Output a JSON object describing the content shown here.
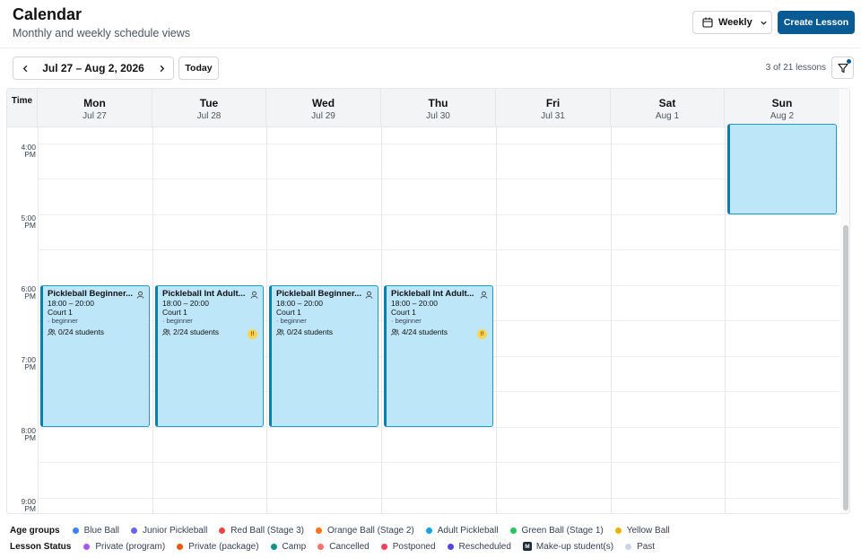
{
  "header": {
    "title": "Calendar",
    "subtitle": "Monthly and weekly schedule views",
    "view_select": "Weekly",
    "create_label": "Create Lesson",
    "accent": "#0a5a93"
  },
  "toolbar": {
    "date_range": "Jul 27 – Aug 2, 2026",
    "today_label": "Today",
    "lesson_count": "3 of 21 lessons"
  },
  "calendar": {
    "time_header": "Time",
    "days": [
      {
        "name": "Mon",
        "date": "Jul 27"
      },
      {
        "name": "Tue",
        "date": "Jul 28"
      },
      {
        "name": "Wed",
        "date": "Jul 29"
      },
      {
        "name": "Thu",
        "date": "Jul 30"
      },
      {
        "name": "Fri",
        "date": "Jul 31"
      },
      {
        "name": "Sat",
        "date": "Aug 1"
      },
      {
        "name": "Sun",
        "date": "Aug 2"
      }
    ],
    "time_labels": [
      {
        "hour": "4:00",
        "ampm": "PM"
      },
      {
        "hour": "5:00",
        "ampm": "PM"
      },
      {
        "hour": "6:00",
        "ampm": "PM"
      },
      {
        "hour": "7:00",
        "ampm": "PM"
      },
      {
        "hour": "8:00",
        "ampm": "PM"
      },
      {
        "hour": "9:00",
        "ampm": "PM"
      }
    ],
    "events": [
      {
        "title": "Pickleball Beginner...",
        "time": "18:00 – 20:00",
        "court": "Court 1",
        "level": "· beginner",
        "students": "0/24 students",
        "warn": false
      },
      {
        "title": "Pickleball Int Adult...",
        "time": "18:00 – 20:00",
        "court": "Court 1",
        "level": "· beginner",
        "students": "2/24 students",
        "warn": true,
        "warn_label": "!!"
      },
      {
        "title": "Pickleball Beginner...",
        "time": "18:00 – 20:00",
        "court": "Court 1",
        "level": "· beginner",
        "students": "0/24 students",
        "warn": false
      },
      {
        "title": "Pickleball Int Adult...",
        "time": "18:00 – 20:00",
        "court": "Court 1",
        "level": "· beginner",
        "students": "4/24 students",
        "warn": true,
        "warn_label": "!!"
      }
    ],
    "event_color": "#bde6f8"
  },
  "legend": {
    "age_groups_title": "Age groups",
    "age_groups": [
      {
        "label": "Blue Ball",
        "color": "#3b82f6"
      },
      {
        "label": "Junior Pickleball",
        "color": "#6366f1"
      },
      {
        "label": "Red Ball (Stage 3)",
        "color": "#ef4444"
      },
      {
        "label": "Orange Ball (Stage 2)",
        "color": "#f97316"
      },
      {
        "label": "Adult Pickleball",
        "color": "#0ea5e9"
      },
      {
        "label": "Green Ball (Stage 1)",
        "color": "#22c55e"
      },
      {
        "label": "Yellow Ball",
        "color": "#eab308"
      }
    ],
    "lesson_status_title": "Lesson Status",
    "lesson_status": [
      {
        "label": "Private (program)",
        "color": "#a855f7"
      },
      {
        "label": "Private (package)",
        "color": "#ea580c"
      },
      {
        "label": "Camp",
        "color": "#0d9488"
      },
      {
        "label": "Cancelled",
        "color": "#f87171"
      },
      {
        "label": "Postponed",
        "color": "#f43f5e"
      },
      {
        "label": "Rescheduled",
        "color": "#4f46e5"
      },
      {
        "label": "Make-up student(s)",
        "badge": "M"
      },
      {
        "label": "Past",
        "color": "#cbd5e1"
      }
    ]
  }
}
